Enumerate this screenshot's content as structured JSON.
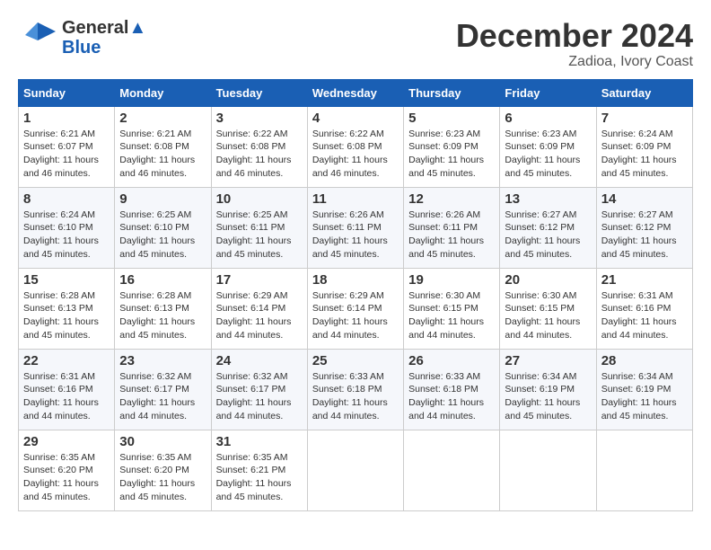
{
  "logo": {
    "line1": "General",
    "line2": "Blue"
  },
  "title": "December 2024",
  "subtitle": "Zadioa, Ivory Coast",
  "days_of_week": [
    "Sunday",
    "Monday",
    "Tuesday",
    "Wednesday",
    "Thursday",
    "Friday",
    "Saturday"
  ],
  "weeks": [
    [
      {
        "day": 1,
        "info": "Sunrise: 6:21 AM\nSunset: 6:07 PM\nDaylight: 11 hours\nand 46 minutes."
      },
      {
        "day": 2,
        "info": "Sunrise: 6:21 AM\nSunset: 6:08 PM\nDaylight: 11 hours\nand 46 minutes."
      },
      {
        "day": 3,
        "info": "Sunrise: 6:22 AM\nSunset: 6:08 PM\nDaylight: 11 hours\nand 46 minutes."
      },
      {
        "day": 4,
        "info": "Sunrise: 6:22 AM\nSunset: 6:08 PM\nDaylight: 11 hours\nand 46 minutes."
      },
      {
        "day": 5,
        "info": "Sunrise: 6:23 AM\nSunset: 6:09 PM\nDaylight: 11 hours\nand 45 minutes."
      },
      {
        "day": 6,
        "info": "Sunrise: 6:23 AM\nSunset: 6:09 PM\nDaylight: 11 hours\nand 45 minutes."
      },
      {
        "day": 7,
        "info": "Sunrise: 6:24 AM\nSunset: 6:09 PM\nDaylight: 11 hours\nand 45 minutes."
      }
    ],
    [
      {
        "day": 8,
        "info": "Sunrise: 6:24 AM\nSunset: 6:10 PM\nDaylight: 11 hours\nand 45 minutes."
      },
      {
        "day": 9,
        "info": "Sunrise: 6:25 AM\nSunset: 6:10 PM\nDaylight: 11 hours\nand 45 minutes."
      },
      {
        "day": 10,
        "info": "Sunrise: 6:25 AM\nSunset: 6:11 PM\nDaylight: 11 hours\nand 45 minutes."
      },
      {
        "day": 11,
        "info": "Sunrise: 6:26 AM\nSunset: 6:11 PM\nDaylight: 11 hours\nand 45 minutes."
      },
      {
        "day": 12,
        "info": "Sunrise: 6:26 AM\nSunset: 6:11 PM\nDaylight: 11 hours\nand 45 minutes."
      },
      {
        "day": 13,
        "info": "Sunrise: 6:27 AM\nSunset: 6:12 PM\nDaylight: 11 hours\nand 45 minutes."
      },
      {
        "day": 14,
        "info": "Sunrise: 6:27 AM\nSunset: 6:12 PM\nDaylight: 11 hours\nand 45 minutes."
      }
    ],
    [
      {
        "day": 15,
        "info": "Sunrise: 6:28 AM\nSunset: 6:13 PM\nDaylight: 11 hours\nand 45 minutes."
      },
      {
        "day": 16,
        "info": "Sunrise: 6:28 AM\nSunset: 6:13 PM\nDaylight: 11 hours\nand 45 minutes."
      },
      {
        "day": 17,
        "info": "Sunrise: 6:29 AM\nSunset: 6:14 PM\nDaylight: 11 hours\nand 44 minutes."
      },
      {
        "day": 18,
        "info": "Sunrise: 6:29 AM\nSunset: 6:14 PM\nDaylight: 11 hours\nand 44 minutes."
      },
      {
        "day": 19,
        "info": "Sunrise: 6:30 AM\nSunset: 6:15 PM\nDaylight: 11 hours\nand 44 minutes."
      },
      {
        "day": 20,
        "info": "Sunrise: 6:30 AM\nSunset: 6:15 PM\nDaylight: 11 hours\nand 44 minutes."
      },
      {
        "day": 21,
        "info": "Sunrise: 6:31 AM\nSunset: 6:16 PM\nDaylight: 11 hours\nand 44 minutes."
      }
    ],
    [
      {
        "day": 22,
        "info": "Sunrise: 6:31 AM\nSunset: 6:16 PM\nDaylight: 11 hours\nand 44 minutes."
      },
      {
        "day": 23,
        "info": "Sunrise: 6:32 AM\nSunset: 6:17 PM\nDaylight: 11 hours\nand 44 minutes."
      },
      {
        "day": 24,
        "info": "Sunrise: 6:32 AM\nSunset: 6:17 PM\nDaylight: 11 hours\nand 44 minutes."
      },
      {
        "day": 25,
        "info": "Sunrise: 6:33 AM\nSunset: 6:18 PM\nDaylight: 11 hours\nand 44 minutes."
      },
      {
        "day": 26,
        "info": "Sunrise: 6:33 AM\nSunset: 6:18 PM\nDaylight: 11 hours\nand 44 minutes."
      },
      {
        "day": 27,
        "info": "Sunrise: 6:34 AM\nSunset: 6:19 PM\nDaylight: 11 hours\nand 45 minutes."
      },
      {
        "day": 28,
        "info": "Sunrise: 6:34 AM\nSunset: 6:19 PM\nDaylight: 11 hours\nand 45 minutes."
      }
    ],
    [
      {
        "day": 29,
        "info": "Sunrise: 6:35 AM\nSunset: 6:20 PM\nDaylight: 11 hours\nand 45 minutes."
      },
      {
        "day": 30,
        "info": "Sunrise: 6:35 AM\nSunset: 6:20 PM\nDaylight: 11 hours\nand 45 minutes."
      },
      {
        "day": 31,
        "info": "Sunrise: 6:35 AM\nSunset: 6:21 PM\nDaylight: 11 hours\nand 45 minutes."
      },
      null,
      null,
      null,
      null
    ]
  ]
}
